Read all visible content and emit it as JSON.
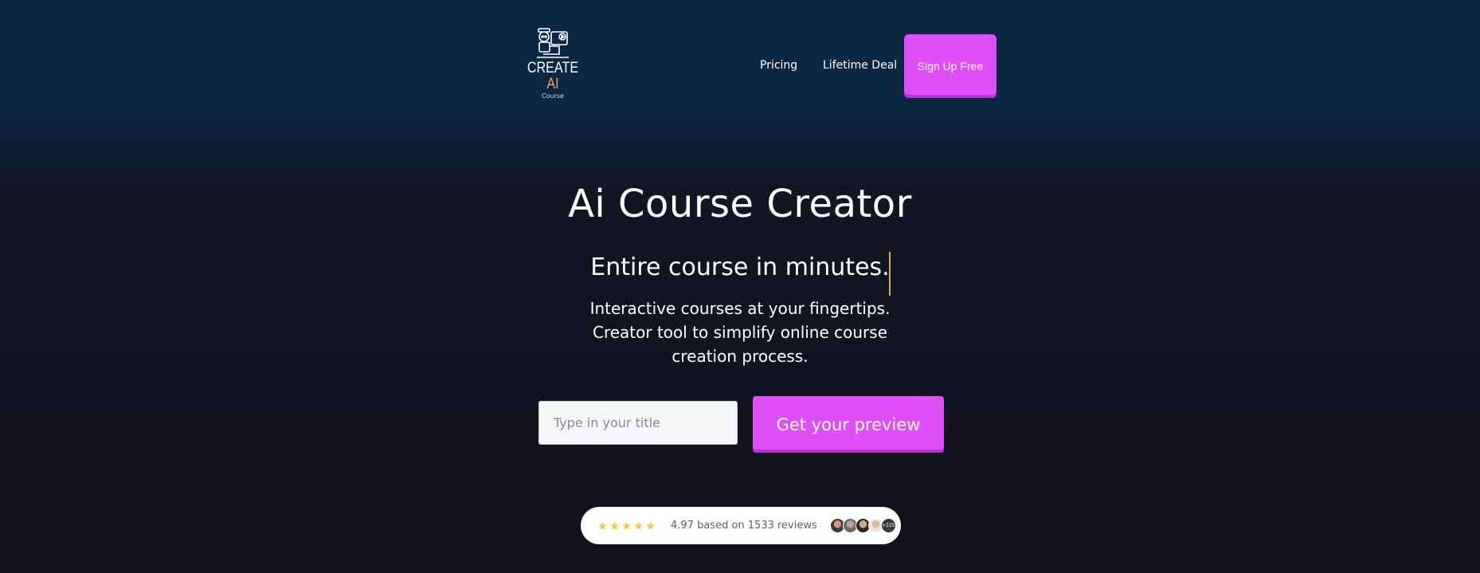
{
  "header": {
    "logo": {
      "word1": "CREATE",
      "word2": "AI",
      "subtitle": "Course",
      "icon": "robot-teacher-icon"
    },
    "nav": {
      "pricing": "Pricing",
      "lifetime_deal": "Lifetime Deal",
      "signup": "Sign Up Free"
    }
  },
  "hero": {
    "title": "Ai Course Creator",
    "typed_text": "Entire course in minutes.",
    "subtitle_lines": [
      "Interactive courses at your fingertips.",
      "Creator tool to simplify online course",
      "creation process."
    ],
    "input_placeholder": "Type in your title",
    "input_value": "",
    "cta_label": "Get your preview"
  },
  "reviews": {
    "stars": 5,
    "text": "4.97 based on 1533 reviews",
    "more_badge": "+225"
  },
  "colors": {
    "accent": "#e04ef8",
    "header_bg": "#0c2744",
    "page_bg": "#12111c",
    "logo_ai": "#f1a06b",
    "star": "#f7c944",
    "caret": "#d8a760"
  }
}
